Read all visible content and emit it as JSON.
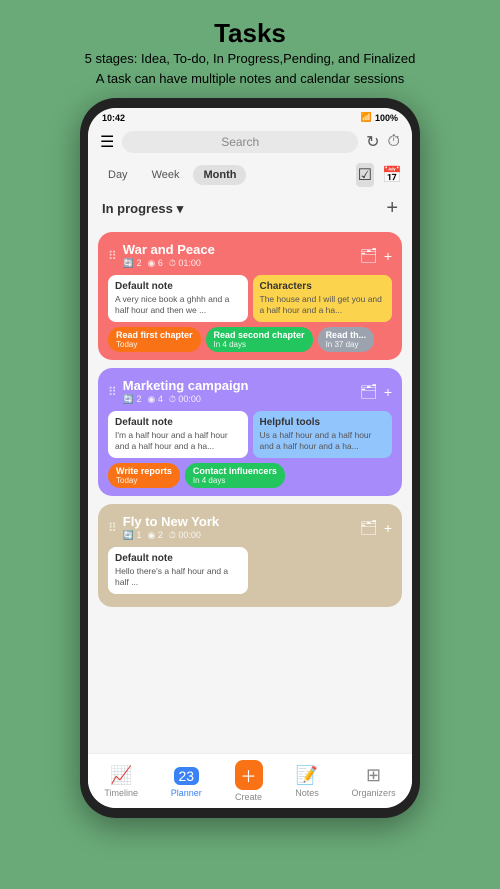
{
  "page": {
    "title": "Tasks",
    "subtitle_line1": "5 stages: Idea, To-do, In Progress,Pending, and Finalized",
    "subtitle_line2": "A task can have multiple notes and calendar sessions"
  },
  "status_bar": {
    "time": "10:42",
    "battery": "100%"
  },
  "top_bar": {
    "search_placeholder": "Search",
    "refresh_icon": "↻",
    "timer_icon": "⏱"
  },
  "nav_tabs": {
    "tabs": [
      {
        "label": "Day",
        "active": false
      },
      {
        "label": "Week",
        "active": false
      },
      {
        "label": "Month",
        "active": true
      }
    ],
    "icons": [
      {
        "name": "check-square-icon",
        "symbol": "☑",
        "active": true
      },
      {
        "name": "calendar-icon",
        "symbol": "📅",
        "active": false
      }
    ]
  },
  "filter_bar": {
    "label": "In progress",
    "dropdown_icon": "▾",
    "add_icon": "+"
  },
  "tasks": [
    {
      "id": "task-1",
      "title": "War and Peace",
      "meta": "2  ◉ 6  ⏱ 01:00",
      "color": "red",
      "notes": [
        {
          "title": "Default note",
          "body": "A very nice book a ghhh and a half hour and then we ...",
          "color": "white"
        },
        {
          "title": "Characters",
          "body": "The house and I will get you and a half hour and a ha...",
          "color": "yellow"
        }
      ],
      "sessions": [
        {
          "label": "Read first chapter",
          "sublabel": "Today",
          "color": "tag-orange"
        },
        {
          "label": "Read second chapter",
          "sublabel": "In 4 days",
          "color": "tag-green"
        },
        {
          "label": "Read th...",
          "sublabel": "In 37 day",
          "color": "tag-gray"
        }
      ]
    },
    {
      "id": "task-2",
      "title": "Marketing campaign",
      "meta": "2  ◉ 4  ⏱ 00:00",
      "color": "purple",
      "notes": [
        {
          "title": "Default note",
          "body": "I'm a half hour and a half hour and a half hour and a ha...",
          "color": "white"
        },
        {
          "title": "Helpful tools",
          "body": "Us a half hour and a half hour and a half hour and a ha...",
          "color": "blue-light"
        }
      ],
      "sessions": [
        {
          "label": "Write reports",
          "sublabel": "Today",
          "color": "tag-orange"
        },
        {
          "label": "Contact influencers",
          "sublabel": "In 4 days",
          "color": "tag-green"
        }
      ]
    },
    {
      "id": "task-3",
      "title": "Fly to New York",
      "meta": "1  ◉ 2  ⏱ 00:00",
      "color": "beige",
      "notes": [
        {
          "title": "Default note",
          "body": "Hello there's a half hour and a half ...",
          "color": "white"
        }
      ],
      "sessions": []
    }
  ],
  "bottom_nav": {
    "items": [
      {
        "label": "Timeline",
        "icon": "📈",
        "active": false
      },
      {
        "label": "Planner",
        "icon": "📅",
        "active": true
      },
      {
        "label": "Create",
        "icon": "＋",
        "active": false
      },
      {
        "label": "Notes",
        "icon": "📝",
        "active": false
      },
      {
        "label": "Organizers",
        "icon": "⊞",
        "active": false
      }
    ]
  }
}
